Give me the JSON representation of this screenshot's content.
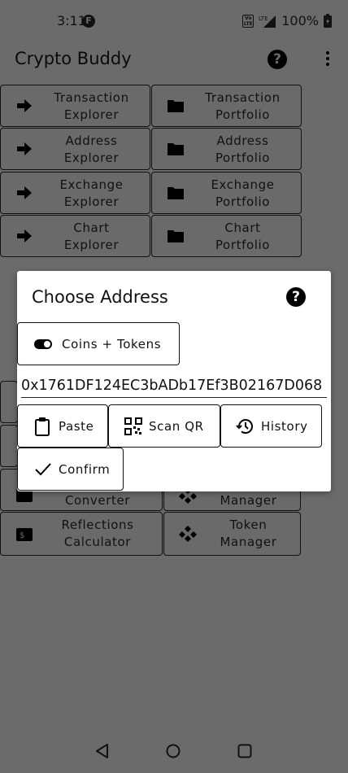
{
  "status": {
    "time": "3:11",
    "f_badge": "F",
    "volte": "Vo LTE",
    "lte": "LTE",
    "battery": "100%"
  },
  "app": {
    "title": "Crypto Buddy"
  },
  "help_glyph": "?",
  "grid": [
    {
      "label": "Transaction\nExplorer",
      "icon": "arrow-right-icon"
    },
    {
      "label": "Transaction\nPortfolio",
      "icon": "folder-icon"
    },
    {
      "label": "Address\nExplorer",
      "icon": "arrow-right-icon"
    },
    {
      "label": "Address\nPortfolio",
      "icon": "folder-icon"
    },
    {
      "label": "Exchange\nExplorer",
      "icon": "arrow-right-icon"
    },
    {
      "label": "Exchange\nPortfolio",
      "icon": "folder-icon"
    },
    {
      "label": "Chart\nExplorer",
      "icon": "arrow-right-icon"
    },
    {
      "label": "Chart\nPortfolio",
      "icon": "folder-icon"
    },
    {
      "label": "Converter",
      "icon": "converter-icon"
    },
    {
      "label": "Manager",
      "icon": "token-icon"
    },
    {
      "label": "Reflections\nCalculator",
      "icon": "calculator-icon"
    },
    {
      "label": "Token\nManager",
      "icon": "token-icon"
    }
  ],
  "dialog": {
    "title": "Choose Address",
    "toggle_label": "Coins + Tokens",
    "address_value": "0x1761DF124EC3bADb17Ef3B02167D068",
    "paste_label": "Paste",
    "scan_label": "Scan QR",
    "history_label": "History",
    "confirm_label": "Confirm"
  },
  "colors": {
    "scrim": "#6b6b6b",
    "dialog": "#ffffff"
  }
}
